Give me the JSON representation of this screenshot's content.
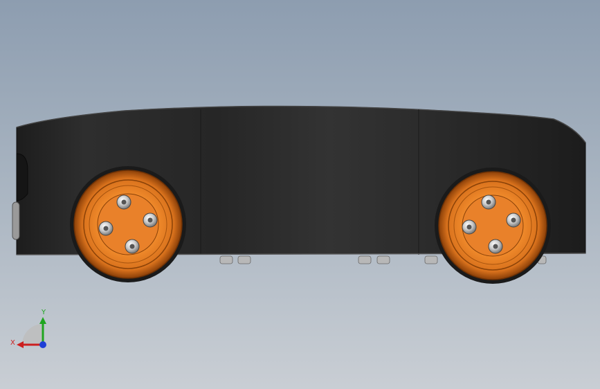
{
  "viewport": {
    "background_top": "#8d9db0",
    "background_bottom": "#c9ced4"
  },
  "model": {
    "body_color": "#2b2b2b",
    "wheel_color": "#e07b22",
    "wheel_count": 2,
    "bolts_per_wheel": 4
  },
  "triad": {
    "x_label": "X",
    "y_label": "Y",
    "x_color": "#cc1f1f",
    "y_color": "#1fa51f",
    "z_color": "#1f3fd6"
  }
}
